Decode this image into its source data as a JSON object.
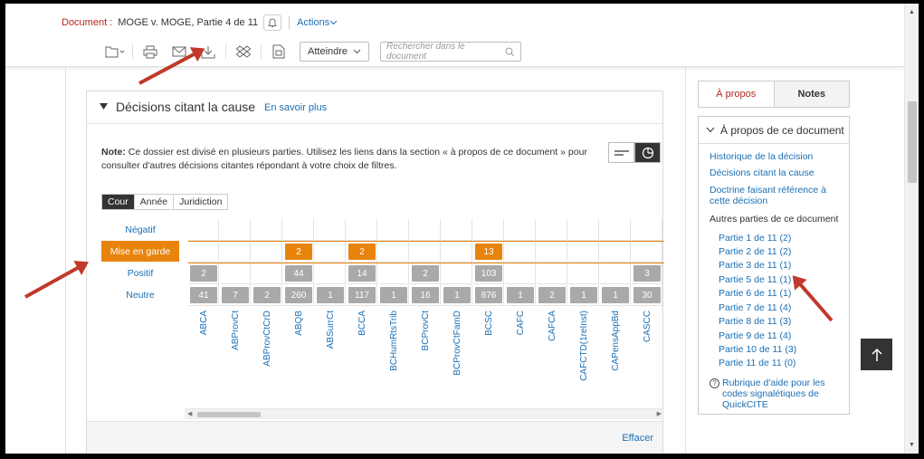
{
  "header": {
    "doc_label": "Document :",
    "doc_title": "MOGE v. MOGE, Partie 4 de 11",
    "actions": "Actions"
  },
  "toolbar": {
    "goto_label": "Atteindre",
    "search_placeholder": "Rechercher dans le document"
  },
  "panel": {
    "title": "Décisions citant la cause",
    "learn_more": "En savoir plus",
    "note_label": "Note:",
    "note_text": "Ce dossier est divisé en plusieurs parties. Utilisez les liens dans la section « à propos de ce document » pour consulter d'autres décisions citantes répondant à votre choix de filtres.",
    "filter_tabs": [
      "Cour",
      "Année",
      "Juridiction"
    ],
    "clear": "Effacer"
  },
  "grid": {
    "rows": [
      "Négatif",
      "Mise en garde",
      "Positif",
      "Neutre"
    ],
    "selected_row": 1,
    "columns": [
      "ABCA",
      "ABProvCt",
      "ABProvCtCrD",
      "ABQB",
      "ABSurrCt",
      "BCCA",
      "BCHumRtsTrib",
      "BCProvCt",
      "BCProvCtFamD",
      "BCSC",
      "CAFC",
      "CAFCA",
      "CAFCTD(1reInst)",
      "CAPensAppBd",
      "CASCC"
    ],
    "cells": [
      [
        "",
        "",
        "",
        "",
        "",
        "",
        "",
        "",
        "",
        "",
        "",
        "",
        "",
        "",
        ""
      ],
      [
        "",
        "",
        "",
        "2",
        "",
        "2",
        "",
        "",
        "",
        "13",
        "",
        "",
        "",
        "",
        ""
      ],
      [
        "2",
        "",
        "",
        "44",
        "",
        "14",
        "",
        "2",
        "",
        "103",
        "",
        "",
        "",
        "",
        "3"
      ],
      [
        "41",
        "7",
        "2",
        "260",
        "1",
        "117",
        "1",
        "16",
        "1",
        "876",
        "1",
        "2",
        "1",
        "1",
        "30"
      ]
    ]
  },
  "sidebar": {
    "tab_about": "À propos",
    "tab_notes": "Notes",
    "section_title": "À propos de ce document",
    "links": [
      "Historique de la décision",
      "Décisions citant la cause",
      "Doctrine faisant référence à cette décision"
    ],
    "other_parts_label": "Autres parties de ce document",
    "parts": [
      "Partie 1 de 11 (2)",
      "Partie 2 de 11 (2)",
      "Partie 3 de 11 (1)",
      "Partie 5 de 11 (1)",
      "Partie 6 de 11 (1)",
      "Partie 7 de 11 (4)",
      "Partie 8 de 11 (3)",
      "Partie 9 de 11 (4)",
      "Partie 10 de 11 (3)",
      "Partie 11 de 11 (0)"
    ],
    "help": "Rubrique d'aide pour les codes signalétiques de QuickCITE"
  },
  "colors": {
    "accent_orange": "#e8830c",
    "link_blue": "#1a6fb5",
    "brand_red": "#b5261e",
    "annotation_arrow": "#c0392b"
  }
}
